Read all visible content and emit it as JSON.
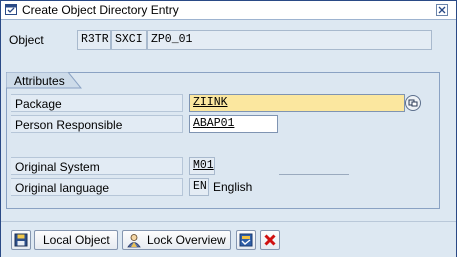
{
  "window": {
    "title": "Create Object Directory Entry",
    "icon": "sap-window-icon",
    "close_icon": "close-icon"
  },
  "object": {
    "label": "Object",
    "pgmid": "R3TR",
    "type": "SXCI",
    "name": "ZP0_01"
  },
  "attributes": {
    "group_label": "Attributes",
    "package_label": "Package",
    "package_value": "ZIINK",
    "package_search_icon": "value-help-icon",
    "person_label": "Person Responsible",
    "person_value": "ABAP01",
    "orig_system_label": "Original System",
    "orig_system_value": "M01",
    "orig_lang_label": "Original language",
    "orig_lang_code": "EN",
    "orig_lang_text": "English"
  },
  "footer": {
    "save_icon": "save-icon",
    "local_object_label": "Local Object",
    "local_object_icon": "local-object-icon",
    "lock_overview_label": "Lock Overview",
    "lock_overview_icon": "person-icon",
    "select_icon": "select-icon",
    "cancel_icon": "cancel-icon"
  },
  "colors": {
    "accent_blue": "#dde8f2",
    "required_field": "#fbe79f",
    "cancel_red": "#d01010"
  }
}
